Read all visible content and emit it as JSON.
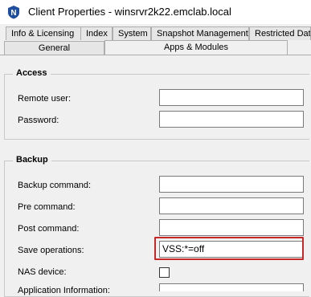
{
  "window": {
    "title": "Client Properties - winsrvr2k22.emclab.local",
    "app_icon": "networker-icon"
  },
  "tabs": {
    "back_row": [
      "Info & Licensing",
      "Index",
      "System",
      "Snapshot Management",
      "Restricted Data"
    ],
    "front_row": [
      "General",
      "Apps & Modules"
    ],
    "selected": "Apps & Modules"
  },
  "access": {
    "title": "Access",
    "remote_user_label": "Remote user:",
    "remote_user_value": "",
    "password_label": "Password:",
    "password_value": ""
  },
  "backup": {
    "title": "Backup",
    "backup_command_label": "Backup command:",
    "backup_command_value": "",
    "pre_command_label": "Pre command:",
    "pre_command_value": "",
    "post_command_label": "Post command:",
    "post_command_value": "",
    "save_operations_label": "Save operations:",
    "save_operations_value": "VSS:*=off",
    "nas_device_label": "NAS device:",
    "nas_device_checked": false,
    "next_label_partial": "Application Information:"
  },
  "colors": {
    "highlight": "#c62828",
    "icon_blue": "#1f4e9e"
  }
}
